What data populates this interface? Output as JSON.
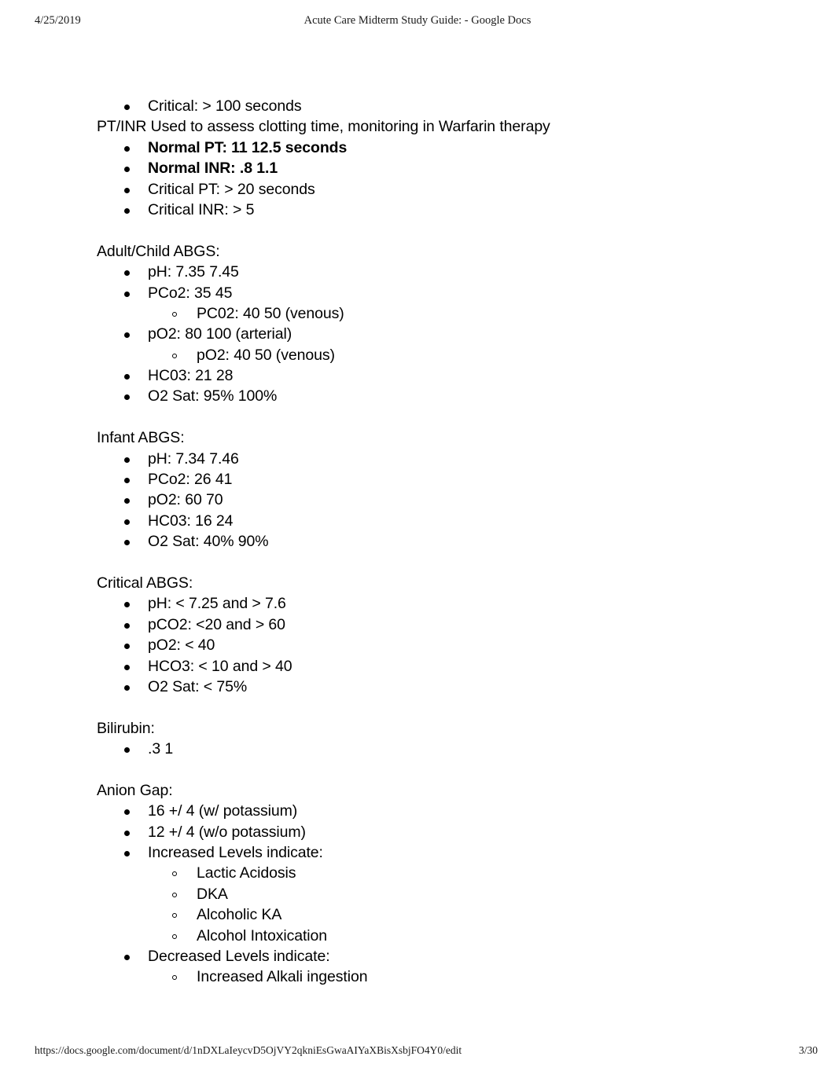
{
  "print_header": {
    "date": "4/25/2019",
    "title": "Acute Care Midterm Study Guide: - Google Docs"
  },
  "print_footer": {
    "url": "https://docs.google.com/document/d/1nDXLaIeycvD5OjVY2qkniEsGwaAIYaXBisXsbjFO4Y0/edit",
    "page": "3/30"
  },
  "document": {
    "lines": [
      {
        "level": 1,
        "bold": false,
        "text": "Critical: > 100 seconds"
      },
      {
        "level": 0,
        "bold": false,
        "text": "PT/INR  Used to assess clotting time, monitoring in Warfarin therapy"
      },
      {
        "level": 1,
        "bold": true,
        "text": "Normal PT: 11  12.5 seconds"
      },
      {
        "level": 1,
        "bold": true,
        "text": "Normal INR: .8  1.1"
      },
      {
        "level": 1,
        "bold": false,
        "text": "Critical PT: > 20 seconds"
      },
      {
        "level": 1,
        "bold": false,
        "text": "Critical INR: > 5"
      },
      {
        "level": -1,
        "bold": false,
        "text": ""
      },
      {
        "level": 0,
        "bold": false,
        "text": "Adult/Child ABGS:"
      },
      {
        "level": 1,
        "bold": false,
        "text": "pH: 7.35  7.45"
      },
      {
        "level": 1,
        "bold": false,
        "text": "PCo2: 35  45"
      },
      {
        "level": 2,
        "bold": false,
        "text": "PC02: 40  50 (venous)"
      },
      {
        "level": 1,
        "bold": false,
        "text": "pO2: 80  100 (arterial)"
      },
      {
        "level": 2,
        "bold": false,
        "text": "pO2: 40  50 (venous)"
      },
      {
        "level": 1,
        "bold": false,
        "text": "HC03: 21  28"
      },
      {
        "level": 1,
        "bold": false,
        "text": "O2 Sat: 95%  100%"
      },
      {
        "level": -1,
        "bold": false,
        "text": ""
      },
      {
        "level": 0,
        "bold": false,
        "text": "Infant ABGS:"
      },
      {
        "level": 1,
        "bold": false,
        "text": "pH: 7.34  7.46"
      },
      {
        "level": 1,
        "bold": false,
        "text": "PCo2: 26  41"
      },
      {
        "level": 1,
        "bold": false,
        "text": "pO2: 60  70"
      },
      {
        "level": 1,
        "bold": false,
        "text": "HC03: 16  24"
      },
      {
        "level": 1,
        "bold": false,
        "text": "O2 Sat: 40%  90%"
      },
      {
        "level": -1,
        "bold": false,
        "text": ""
      },
      {
        "level": 0,
        "bold": false,
        "text": "Critical ABGS:"
      },
      {
        "level": 1,
        "bold": false,
        "text": "pH: < 7.25 and > 7.6"
      },
      {
        "level": 1,
        "bold": false,
        "text": "pCO2: <20 and > 60"
      },
      {
        "level": 1,
        "bold": false,
        "text": "pO2: < 40"
      },
      {
        "level": 1,
        "bold": false,
        "text": "HCO3: < 10 and > 40"
      },
      {
        "level": 1,
        "bold": false,
        "text": "O2 Sat: < 75%"
      },
      {
        "level": -1,
        "bold": false,
        "text": ""
      },
      {
        "level": 0,
        "bold": false,
        "text": "Bilirubin:"
      },
      {
        "level": 1,
        "bold": false,
        "text": ".3  1"
      },
      {
        "level": -1,
        "bold": false,
        "text": ""
      },
      {
        "level": 0,
        "bold": false,
        "text": "Anion Gap:"
      },
      {
        "level": 1,
        "bold": false,
        "text": "16 +/ 4 (w/ potassium)"
      },
      {
        "level": 1,
        "bold": false,
        "text": "12 +/ 4 (w/o potassium)"
      },
      {
        "level": 1,
        "bold": false,
        "text": "Increased Levels indicate:"
      },
      {
        "level": 2,
        "bold": false,
        "text": "Lactic Acidosis"
      },
      {
        "level": 2,
        "bold": false,
        "text": "DKA"
      },
      {
        "level": 2,
        "bold": false,
        "text": "Alcoholic KA"
      },
      {
        "level": 2,
        "bold": false,
        "text": "Alcohol Intoxication"
      },
      {
        "level": 1,
        "bold": false,
        "text": "Decreased Levels indicate:"
      },
      {
        "level": 2,
        "bold": false,
        "text": "Increased Alkali ingestion"
      }
    ]
  }
}
